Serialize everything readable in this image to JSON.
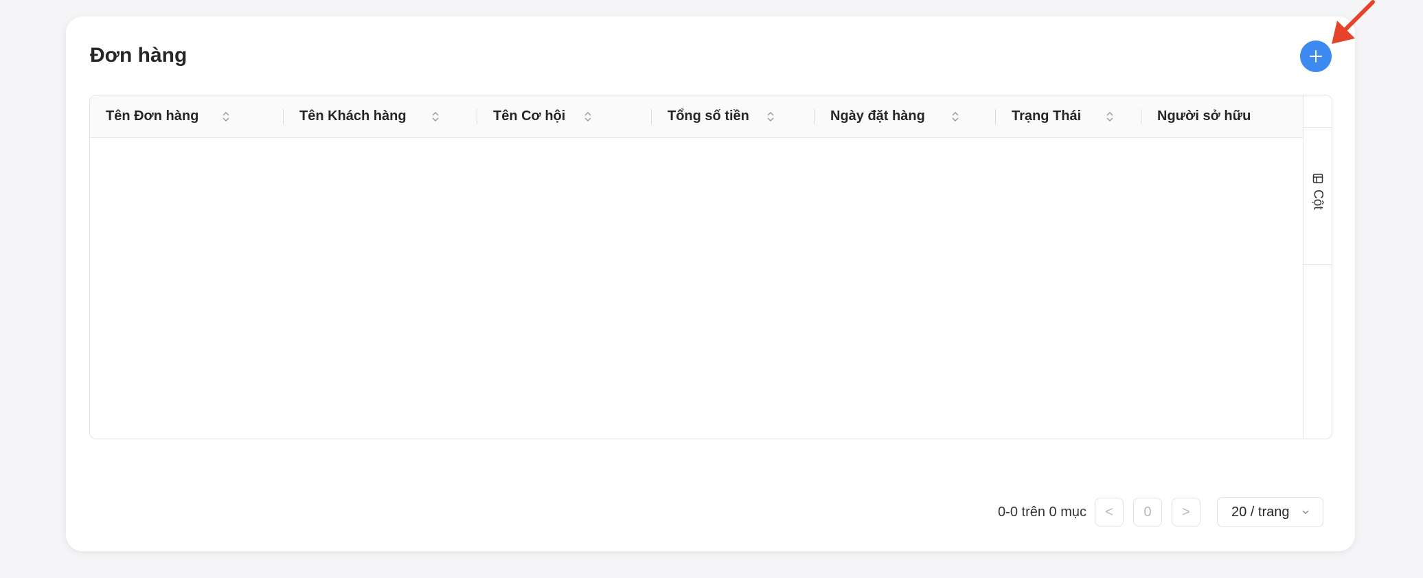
{
  "page": {
    "title": "Đơn hàng"
  },
  "table": {
    "columns": [
      {
        "label": "Tên Đơn hàng",
        "sortable": true
      },
      {
        "label": "Tên Khách hàng",
        "sortable": true
      },
      {
        "label": "Tên Cơ hội",
        "sortable": true
      },
      {
        "label": "Tổng số tiền",
        "sortable": true
      },
      {
        "label": "Ngày đặt hàng",
        "sortable": true
      },
      {
        "label": "Trạng Thái",
        "sortable": true
      },
      {
        "label": "Người sở hữu",
        "sortable": false
      }
    ],
    "rows": [],
    "columns_toggle_label": "Cột"
  },
  "pagination": {
    "range_text": "0-0 trên 0 mục",
    "current_page": "0",
    "prev_label": "<",
    "next_label": ">",
    "page_size": "20 / trang"
  },
  "colors": {
    "accent": "#3d8bf0",
    "annotation_arrow": "#e5442b"
  },
  "icons": {
    "add": "plus-icon",
    "sort": "sort-icon",
    "columns": "table-columns-icon",
    "chevron": "chevron-down-icon"
  }
}
